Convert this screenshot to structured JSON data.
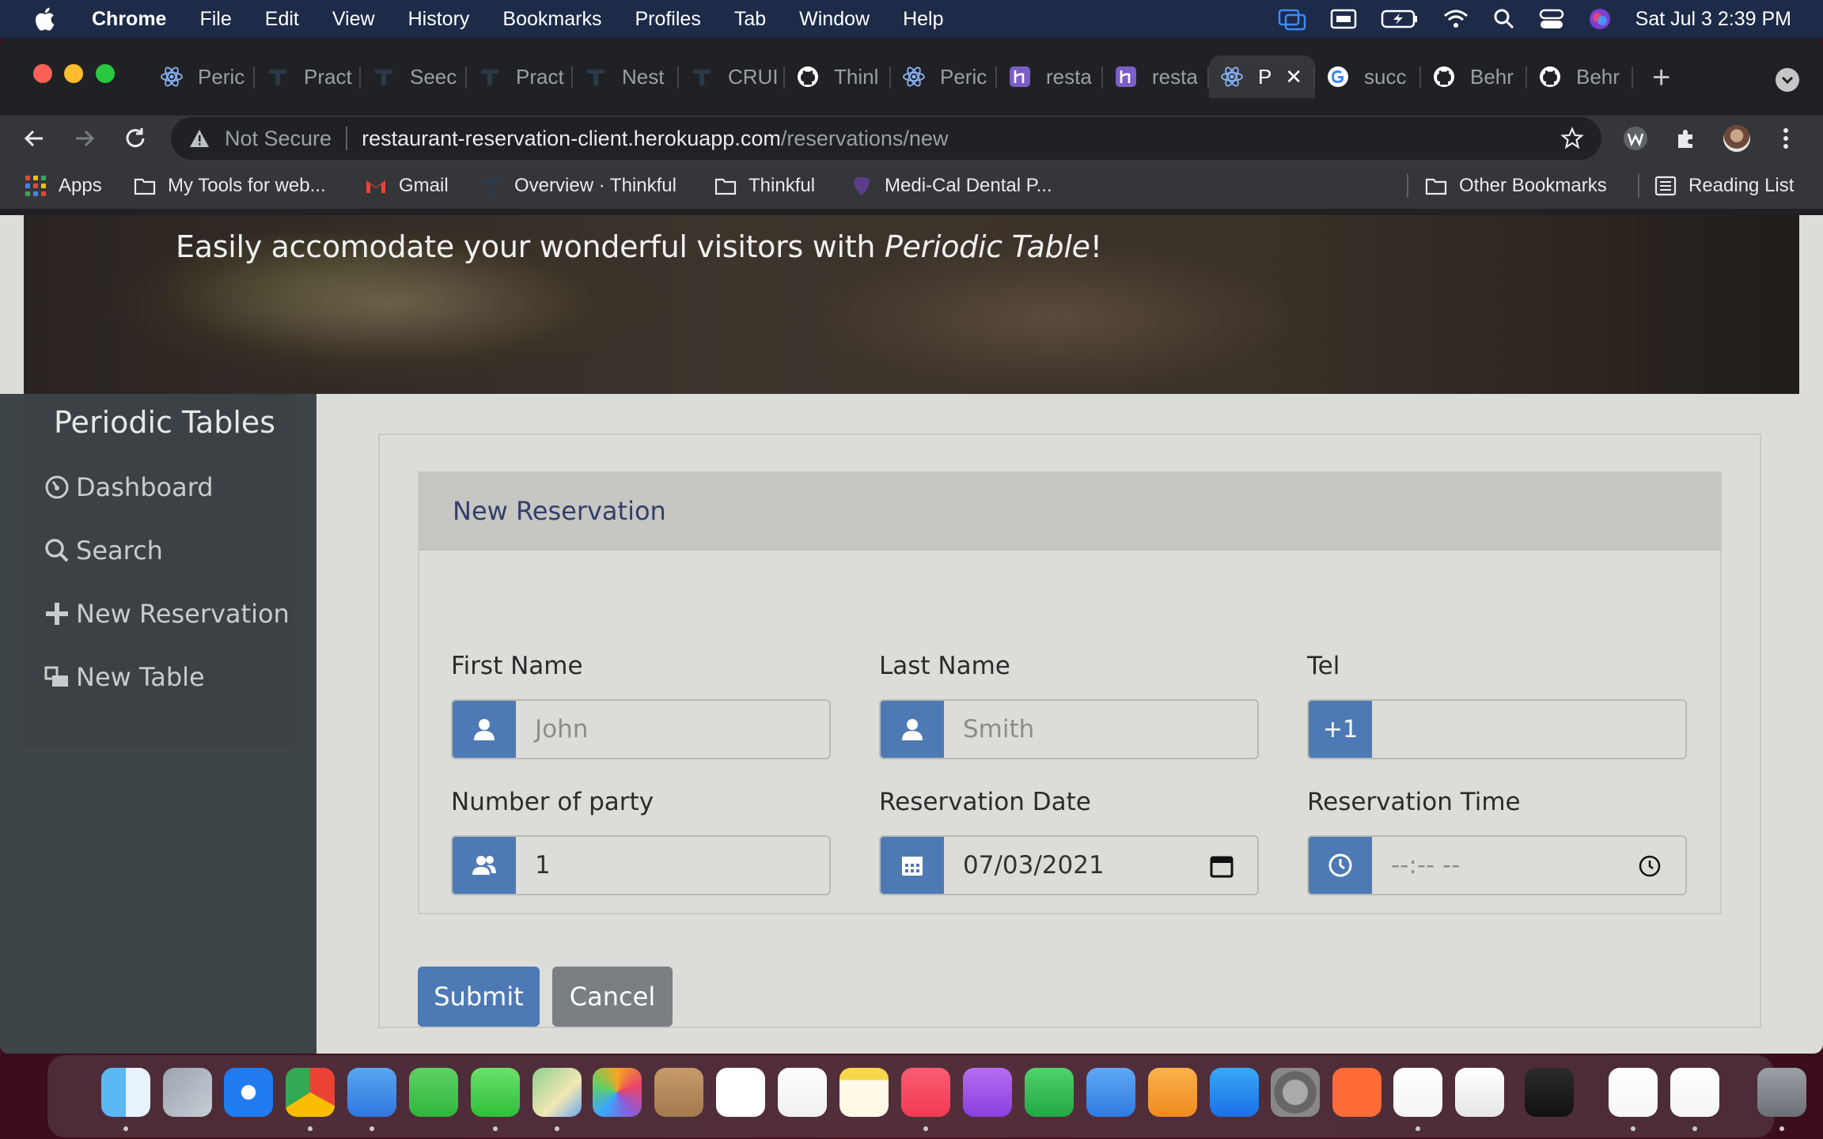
{
  "menubar": {
    "app": "Chrome",
    "items": [
      "File",
      "Edit",
      "View",
      "History",
      "Bookmarks",
      "Profiles",
      "Tab",
      "Window",
      "Help"
    ],
    "clock": "Sat Jul 3  2:39 PM"
  },
  "tabs": [
    {
      "title": "Peric",
      "icon": "react-icon"
    },
    {
      "title": "Pract",
      "icon": "thinkful-icon"
    },
    {
      "title": "Seec",
      "icon": "thinkful-icon"
    },
    {
      "title": "Pract",
      "icon": "thinkful-icon"
    },
    {
      "title": "Nest",
      "icon": "thinkful-icon"
    },
    {
      "title": "CRUI",
      "icon": "thinkful-icon"
    },
    {
      "title": "Thinl",
      "icon": "github-icon"
    },
    {
      "title": "Peric",
      "icon": "react-icon"
    },
    {
      "title": "resta",
      "icon": "heroku-icon"
    },
    {
      "title": "resta",
      "icon": "heroku-icon"
    },
    {
      "title": "P",
      "icon": "react-icon",
      "active": true
    },
    {
      "title": "succ",
      "icon": "google-icon"
    },
    {
      "title": "Behr",
      "icon": "github-icon"
    },
    {
      "title": "Behr",
      "icon": "github-icon"
    }
  ],
  "omnibox": {
    "security": "Not Secure",
    "host": "restaurant-reservation-client.herokuapp.com",
    "path": "/reservations/new"
  },
  "bookmarks": {
    "apps": "Apps",
    "items": [
      "My Tools for web...",
      "Gmail",
      "Overview · Thinkful",
      "Thinkful",
      "Medi-Cal Dental P..."
    ],
    "other": "Other Bookmarks",
    "reading": "Reading List"
  },
  "hero": {
    "tagline_prefix": "Easily accomodate your wonderful visitors with ",
    "tagline_em": "Periodic Table",
    "tagline_suffix": "!"
  },
  "sidebar": {
    "brand": "Periodic Tables",
    "items": [
      {
        "label": "Dashboard",
        "icon": "dashboard-icon"
      },
      {
        "label": "Search",
        "icon": "search-icon"
      },
      {
        "label": "New Reservation",
        "icon": "plus-icon"
      },
      {
        "label": "New Table",
        "icon": "table-icon"
      }
    ]
  },
  "form": {
    "title": "New Reservation",
    "first_name": {
      "label": "First Name",
      "placeholder": "John",
      "value": ""
    },
    "last_name": {
      "label": "Last Name",
      "placeholder": "Smith",
      "value": ""
    },
    "tel": {
      "label": "Tel",
      "prefix": "+1",
      "value": ""
    },
    "party": {
      "label": "Number of party",
      "value": "1"
    },
    "date": {
      "label": "Reservation Date",
      "value": "07/03/2021"
    },
    "time": {
      "label": "Reservation Time",
      "value": "--:-- --"
    },
    "submit": "Submit",
    "cancel": "Cancel"
  },
  "colors": {
    "primary": "#4d7ab5",
    "secondary": "#7a7f84",
    "sidebar": "#3e4548",
    "page_bg": "#dcdcd8"
  }
}
